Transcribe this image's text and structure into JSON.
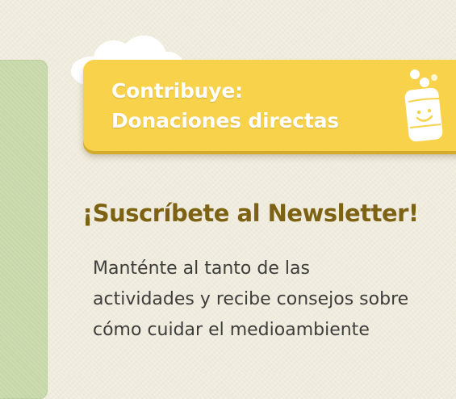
{
  "donate_banner": {
    "line1": "Contribuye:",
    "line2": "Donaciones directas",
    "icon": "smiling-can-icon"
  },
  "newsletter": {
    "heading": "¡Suscríbete al Newsletter!",
    "description_lines": [
      "Manténte al tanto de las",
      "actividades y recibe consejos sobre",
      "cómo cuidar el medioambiente"
    ]
  },
  "colors": {
    "background": "#efebdd",
    "sidebar_green": "#c6d8a8",
    "banner_yellow": "#f7d24a",
    "heading_brown": "#7d6214",
    "body_text": "#3d3d3b"
  }
}
